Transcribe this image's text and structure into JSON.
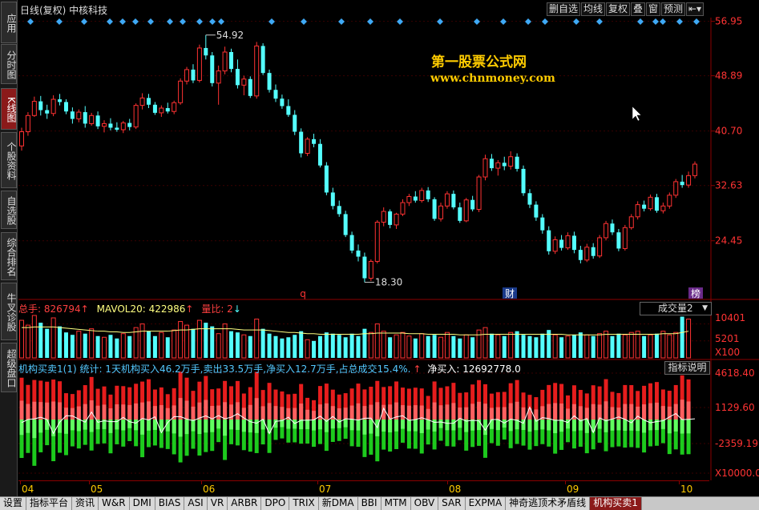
{
  "leftnav": [
    {
      "label": "应用",
      "active": false
    },
    {
      "label": "分时图",
      "active": false
    },
    {
      "label": "K线图",
      "active": true
    },
    {
      "label": "个股资料",
      "active": false
    },
    {
      "label": "自选股",
      "active": false
    },
    {
      "label": "综合排名",
      "active": false
    },
    {
      "label": "牛叉诊股",
      "active": false
    },
    {
      "label": "超级盘口",
      "active": false
    }
  ],
  "title": "日线(复权)  中核科技",
  "toolbar": {
    "del_fav": "删自选",
    "ma": "均线",
    "fq": "复权",
    "overlay": "叠",
    "window": "窗",
    "forecast": "预测",
    "arrow_btn": "⇤▾"
  },
  "watermark": {
    "line1": "第一股票公式网",
    "line2": "www.chnmoney.com"
  },
  "price_axis": [
    "56.95",
    "48.89",
    "40.70",
    "32.63",
    "24.45"
  ],
  "annotations": {
    "high": "54.92",
    "low": "18.30",
    "q_mark": "q",
    "cai_mark": "财",
    "bang_mark": "榜"
  },
  "volume": {
    "total_label": "总手: 826794",
    "mavol_label": "MAVOL20: 422986",
    "ratio_label": "量比: 2",
    "dropdown": "成交量2",
    "axis": [
      "10401",
      "5201",
      "X100"
    ]
  },
  "indicator": {
    "title": "机构买卖1(1) 统计: 1天机构买入46.2万手,卖出33.5万手,净买入12.7万手,占总成交15.4%.",
    "net_label": "净买入: 12692778.0",
    "explain_btn": "指标说明",
    "axis": [
      "4618.40",
      "1129.60",
      "-2359.19",
      "X10000.0"
    ]
  },
  "dates": [
    "04",
    "05",
    "06",
    "07",
    "08",
    "09",
    "10"
  ],
  "tabs": [
    "设置",
    "指标平台",
    "资讯",
    "W&R",
    "DMI",
    "BIAS",
    "ASI",
    "VR",
    "ARBR",
    "DPO",
    "TRIX",
    "新DMA",
    "BBI",
    "MTM",
    "OBV",
    "SAR",
    "EXPMA",
    "神奇逃顶术矛盾线",
    "机构买卖1"
  ],
  "active_tab": "机构买卖1",
  "colors": {
    "up": "#ff3232",
    "down": "#54ffff",
    "ma": "#ffff80",
    "buy": "#ff2020",
    "sell": "#20e020",
    "diamond": "#3fa9f5"
  },
  "chart_data": {
    "type": "candlestick",
    "price_range": [
      16.0,
      57.5
    ],
    "candles": [
      [
        38.5,
        41.2,
        37.8,
        40.6
      ],
      [
        40.6,
        43.5,
        40.0,
        43.0
      ],
      [
        43.0,
        45.8,
        42.8,
        45.1
      ],
      [
        45.1,
        45.9,
        43.0,
        43.8
      ],
      [
        43.8,
        44.6,
        42.5,
        43.3
      ],
      [
        43.3,
        46.0,
        42.9,
        45.4
      ],
      [
        45.4,
        46.2,
        44.5,
        45.0
      ],
      [
        45.0,
        45.4,
        43.2,
        43.6
      ],
      [
        43.6,
        44.2,
        41.8,
        42.5
      ],
      [
        42.5,
        43.9,
        42.0,
        43.5
      ],
      [
        43.5,
        44.4,
        41.2,
        41.8
      ],
      [
        41.8,
        43.4,
        41.5,
        43.0
      ],
      [
        43.0,
        43.6,
        41.0,
        41.4
      ],
      [
        41.4,
        42.3,
        40.5,
        41.8
      ],
      [
        41.8,
        42.6,
        40.8,
        41.2
      ],
      [
        41.2,
        42.0,
        40.6,
        40.9
      ],
      [
        40.9,
        42.2,
        40.4,
        41.9
      ],
      [
        41.9,
        42.5,
        40.8,
        41.3
      ],
      [
        41.3,
        44.8,
        41.0,
        44.5
      ],
      [
        44.5,
        46.3,
        43.9,
        45.6
      ],
      [
        45.6,
        46.2,
        44.1,
        44.6
      ],
      [
        44.6,
        45.0,
        43.1,
        43.4
      ],
      [
        43.4,
        44.5,
        42.8,
        44.1
      ],
      [
        44.1,
        44.9,
        43.3,
        43.6
      ],
      [
        43.6,
        45.2,
        43.2,
        44.9
      ],
      [
        44.9,
        48.5,
        44.6,
        48.1
      ],
      [
        48.1,
        50.2,
        47.6,
        49.8
      ],
      [
        49.8,
        50.6,
        47.8,
        48.2
      ],
      [
        48.2,
        53.5,
        47.9,
        53.0
      ],
      [
        53.0,
        54.92,
        51.3,
        51.9
      ],
      [
        51.9,
        52.4,
        47.3,
        47.8
      ],
      [
        47.8,
        50.4,
        44.6,
        49.6
      ],
      [
        49.6,
        53.2,
        49.1,
        52.4
      ],
      [
        52.4,
        52.9,
        49.4,
        49.9
      ],
      [
        49.9,
        51.3,
        47.0,
        47.5
      ],
      [
        47.5,
        48.9,
        46.0,
        48.4
      ],
      [
        48.4,
        48.8,
        45.6,
        45.9
      ],
      [
        45.9,
        53.9,
        45.5,
        53.3
      ],
      [
        53.3,
        53.7,
        49.0,
        49.3
      ],
      [
        49.3,
        49.8,
        46.4,
        46.8
      ],
      [
        46.8,
        47.6,
        45.0,
        45.5
      ],
      [
        45.5,
        46.1,
        44.0,
        44.4
      ],
      [
        44.4,
        45.4,
        42.8,
        43.1
      ],
      [
        43.1,
        43.8,
        40.1,
        40.6
      ],
      [
        40.6,
        41.1,
        36.8,
        37.4
      ],
      [
        37.4,
        39.8,
        37.0,
        39.5
      ],
      [
        39.5,
        40.3,
        38.3,
        38.8
      ],
      [
        38.8,
        39.5,
        35.3,
        35.6
      ],
      [
        35.6,
        36.1,
        31.2,
        31.6
      ],
      [
        31.6,
        32.3,
        29.1,
        29.6
      ],
      [
        29.6,
        30.4,
        28.0,
        28.4
      ],
      [
        28.4,
        28.9,
        25.0,
        25.3
      ],
      [
        25.3,
        25.8,
        22.6,
        23.0
      ],
      [
        23.0,
        23.9,
        21.4,
        22.1
      ],
      [
        22.1,
        22.7,
        18.3,
        18.9
      ],
      [
        18.9,
        21.7,
        18.5,
        21.4
      ],
      [
        21.4,
        27.5,
        21.1,
        27.2
      ],
      [
        27.2,
        29.4,
        26.6,
        28.8
      ],
      [
        28.8,
        29.1,
        26.3,
        26.8
      ],
      [
        26.8,
        28.6,
        26.2,
        28.4
      ],
      [
        28.4,
        30.6,
        28.1,
        30.1
      ],
      [
        30.1,
        31.4,
        29.6,
        31.0
      ],
      [
        31.0,
        31.8,
        30.1,
        30.4
      ],
      [
        30.4,
        32.3,
        30.1,
        31.9
      ],
      [
        31.9,
        32.4,
        30.2,
        30.6
      ],
      [
        30.6,
        30.9,
        27.4,
        27.7
      ],
      [
        27.7,
        30.1,
        27.3,
        29.6
      ],
      [
        29.6,
        31.8,
        29.2,
        31.4
      ],
      [
        31.4,
        31.9,
        29.1,
        29.4
      ],
      [
        29.4,
        30.1,
        27.1,
        27.4
      ],
      [
        27.4,
        30.8,
        27.2,
        30.5
      ],
      [
        30.5,
        31.1,
        28.8,
        29.1
      ],
      [
        29.1,
        34.2,
        28.7,
        33.9
      ],
      [
        33.9,
        37.2,
        33.4,
        36.6
      ],
      [
        36.6,
        37.3,
        34.8,
        35.2
      ],
      [
        35.2,
        36.4,
        34.1,
        36.0
      ],
      [
        36.0,
        36.9,
        34.9,
        35.5
      ],
      [
        35.5,
        37.7,
        35.0,
        36.9
      ],
      [
        36.9,
        37.4,
        34.7,
        35.1
      ],
      [
        35.1,
        35.6,
        31.1,
        31.5
      ],
      [
        31.5,
        32.1,
        29.3,
        29.8
      ],
      [
        29.8,
        30.3,
        27.4,
        27.9
      ],
      [
        27.9,
        28.4,
        25.5,
        26.0
      ],
      [
        26.0,
        26.6,
        22.4,
        22.9
      ],
      [
        22.9,
        25.1,
        22.5,
        24.6
      ],
      [
        24.6,
        25.3,
        23.0,
        23.4
      ],
      [
        23.4,
        25.7,
        23.1,
        25.2
      ],
      [
        25.2,
        25.8,
        22.6,
        23.1
      ],
      [
        23.1,
        23.7,
        21.1,
        21.6
      ],
      [
        21.6,
        24.0,
        21.3,
        23.5
      ],
      [
        23.5,
        24.1,
        21.8,
        22.2
      ],
      [
        22.2,
        25.3,
        21.9,
        24.9
      ],
      [
        24.9,
        27.4,
        24.5,
        27.0
      ],
      [
        27.0,
        27.6,
        25.3,
        25.7
      ],
      [
        25.7,
        26.2,
        22.9,
        23.3
      ],
      [
        23.3,
        26.8,
        23.0,
        26.4
      ],
      [
        26.4,
        28.4,
        26.1,
        28.0
      ],
      [
        28.0,
        30.3,
        27.6,
        29.8
      ],
      [
        29.8,
        30.4,
        28.8,
        29.2
      ],
      [
        29.2,
        31.3,
        28.9,
        30.9
      ],
      [
        30.9,
        31.4,
        28.6,
        28.9
      ],
      [
        28.9,
        30.1,
        28.5,
        29.6
      ],
      [
        29.6,
        31.6,
        29.2,
        31.2
      ],
      [
        31.2,
        33.6,
        30.8,
        33.2
      ],
      [
        33.2,
        34.2,
        32.3,
        32.7
      ],
      [
        32.7,
        34.7,
        32.3,
        34.1
      ],
      [
        34.1,
        36.2,
        33.7,
        35.8
      ]
    ],
    "volume": [
      62,
      54,
      70,
      58,
      48,
      66,
      52,
      42,
      38,
      44,
      40,
      48,
      36,
      34,
      38,
      32,
      40,
      36,
      50,
      56,
      44,
      36,
      42,
      34,
      46,
      60,
      54,
      48,
      62,
      58,
      52,
      40,
      56,
      44,
      42,
      38,
      36,
      64,
      48,
      40,
      36,
      32,
      34,
      38,
      44,
      30,
      28,
      36,
      42,
      40,
      38,
      34,
      40,
      36,
      48,
      42,
      56,
      44,
      34,
      38,
      42,
      36,
      32,
      40,
      36,
      38,
      34,
      42,
      36,
      32,
      38,
      34,
      46,
      50,
      40,
      38,
      36,
      42,
      44,
      38,
      36,
      34,
      40,
      46,
      38,
      34,
      36,
      38,
      42,
      38,
      36,
      40,
      44,
      36,
      40,
      38,
      42,
      44,
      36,
      38,
      40,
      44,
      38,
      42,
      68,
      64
    ],
    "mavol": [
      50,
      50,
      51,
      51,
      51,
      51,
      50,
      49,
      48,
      47,
      46,
      45,
      44,
      44,
      43,
      43,
      42,
      42,
      43,
      44,
      44,
      44,
      44,
      44,
      45,
      46,
      46,
      47,
      48,
      48,
      48,
      48,
      48,
      48,
      47,
      46,
      46,
      46,
      46,
      45,
      44,
      43,
      42,
      42,
      41,
      40,
      40,
      39,
      39,
      39,
      39,
      39,
      39,
      39,
      40,
      40,
      41,
      41,
      41,
      41,
      41,
      40,
      40,
      40,
      39,
      39,
      39,
      39,
      39,
      38,
      38,
      38,
      38,
      39,
      39,
      39,
      39,
      39,
      39,
      39,
      39,
      39,
      39,
      39,
      39,
      39,
      38,
      38,
      38,
      38,
      38,
      38,
      39,
      39,
      39,
      39,
      39,
      39,
      39,
      39,
      39,
      40,
      40,
      40,
      42,
      44
    ]
  }
}
